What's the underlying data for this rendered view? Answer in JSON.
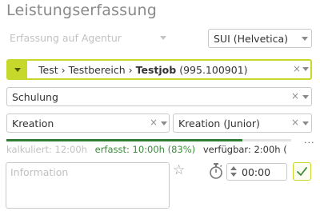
{
  "panel": {
    "title": "Leistungserfassung"
  },
  "agent_select": {
    "placeholder": "Erfassung auf Agentur"
  },
  "client_select": {
    "value": "SUI (Helvetica)"
  },
  "job_select": {
    "path_1": "Test",
    "separator": "›",
    "path_2": "Testbereich",
    "job_name": "Testjob",
    "job_number": "(995.100901)"
  },
  "activity_select": {
    "value": "Schulung"
  },
  "department_select": {
    "value": "Kreation"
  },
  "role_select": {
    "value": "Kreation (Junior)"
  },
  "budget": {
    "calculated": "kalkuliert: 12:00h",
    "recorded": "erfasst: 10:00h (83%)",
    "available": "verfügbar: 2:00h (",
    "progress_fraction": 0.83,
    "more": "..."
  },
  "info_field": {
    "placeholder": "Information"
  },
  "time_input": {
    "value": "00:00"
  },
  "icons": {
    "clear": "×",
    "star": "☆",
    "check": "check-icon",
    "stopwatch": "stopwatch-icon"
  },
  "colors": {
    "accent": "#c6d82b",
    "recorded_text": "#3a8a3a",
    "progress_fill": "#2e7d32",
    "muted_text": "#c0c0c0"
  }
}
